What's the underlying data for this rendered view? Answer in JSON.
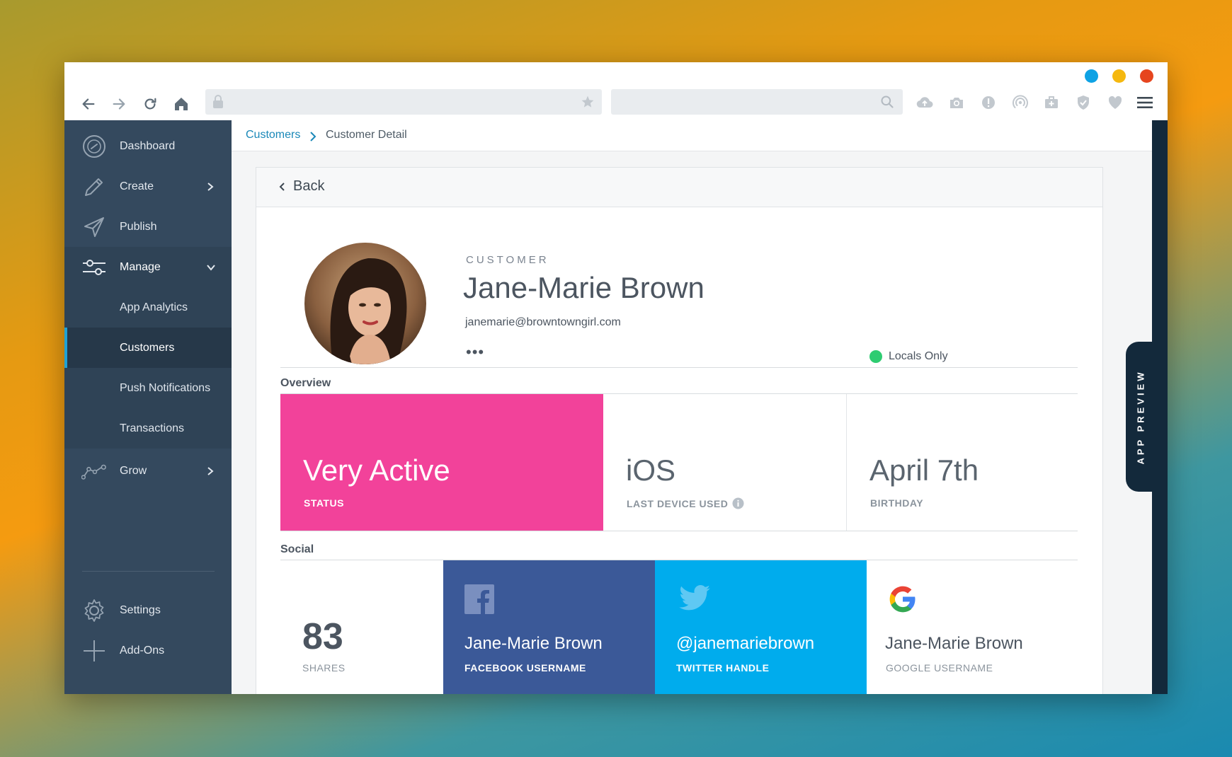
{
  "window": {
    "controls": {
      "blue": "#0ea2e4",
      "yellow": "#f5b80f",
      "red": "#e6451e"
    }
  },
  "toolbar": {
    "icons": [
      "back-arrow-icon",
      "forward-arrow-icon",
      "reload-icon",
      "home-icon",
      "lock-icon",
      "star-icon",
      "search-icon",
      "cloud-upload-icon",
      "camera-icon",
      "alert-icon",
      "broadcast-icon",
      "briefcase-icon",
      "shield-icon",
      "heart-icon",
      "menu-icon"
    ]
  },
  "sidebar": {
    "items": [
      {
        "label": "Dashboard",
        "icon": "speedometer-icon"
      },
      {
        "label": "Create",
        "icon": "pencil-icon"
      },
      {
        "label": "Publish",
        "icon": "paper-plane-icon"
      },
      {
        "label": "Manage",
        "icon": "sliders-icon"
      }
    ],
    "manage_sub": [
      "App Analytics",
      "Customers",
      "Push Notifications",
      "Transactions"
    ],
    "grow": {
      "label": "Grow",
      "icon": "graph-icon"
    },
    "settings": {
      "label": "Settings",
      "icon": "gear-icon"
    },
    "addons": {
      "label": "Add-Ons",
      "icon": "plus-icon"
    }
  },
  "breadcrumb": {
    "parent": "Customers",
    "current": "Customer Detail"
  },
  "card": {
    "back_label": "Back"
  },
  "profile": {
    "kicker": "CUSTOMER",
    "name": "Jane-Marie Brown",
    "email": "janemarie@browntowngirl.com",
    "more": "•••",
    "segment": "Locals Only"
  },
  "overview": {
    "label": "Overview",
    "status": {
      "value": "Very Active",
      "caption": "STATUS",
      "color": "#f2429a"
    },
    "device": {
      "value": "iOS",
      "caption": "LAST DEVICE USED"
    },
    "birthday": {
      "value": "April 7th",
      "caption": "BIRTHDAY"
    }
  },
  "social": {
    "label": "Social",
    "shares": {
      "value": "83",
      "caption": "SHARES"
    },
    "facebook": {
      "value": "Jane-Marie Brown",
      "caption": "FACEBOOK USERNAME",
      "color": "#3b5998"
    },
    "twitter": {
      "value": "@janemariebrown",
      "caption": "TWITTER HANDLE",
      "color": "#00aced"
    },
    "google": {
      "value": "Jane-Marie Brown",
      "caption": "GOOGLE USERNAME"
    }
  },
  "preview": {
    "label": "APP PREVIEW"
  }
}
